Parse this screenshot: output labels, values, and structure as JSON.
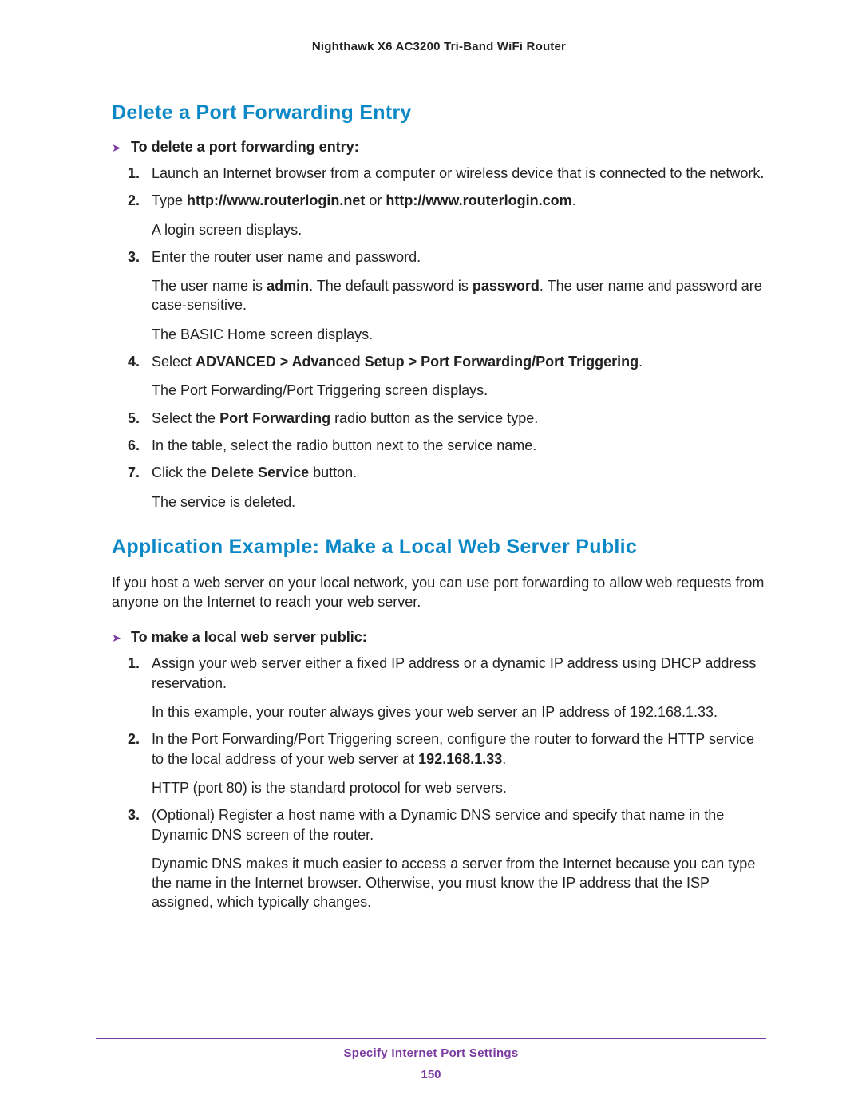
{
  "running_header": "Nighthawk X6 AC3200 Tri-Band WiFi Router",
  "section1": {
    "title": "Delete a Port Forwarding Entry",
    "lead": "To delete a port forwarding entry:",
    "steps": {
      "s1": "Launch an Internet browser from a computer or wireless device that is connected to the network.",
      "s2_pre": "Type ",
      "s2_b1": "http://www.routerlogin.net",
      "s2_mid": " or ",
      "s2_b2": "http://www.routerlogin.com",
      "s2_post": ".",
      "s2_p1": "A login screen displays.",
      "s3": "Enter the router user name and password.",
      "s3_p1_a": "The user name is ",
      "s3_p1_b1": "admin",
      "s3_p1_b": ". The default password is ",
      "s3_p1_b2": "password",
      "s3_p1_c": ". The user name and password are case-sensitive.",
      "s3_p2": "The BASIC Home screen displays.",
      "s4_pre": "Select ",
      "s4_b": "ADVANCED > Advanced Setup > Port Forwarding/Port Triggering",
      "s4_post": ".",
      "s4_p1": "The Port Forwarding/Port Triggering screen displays.",
      "s5_pre": "Select the ",
      "s5_b": "Port Forwarding",
      "s5_post": " radio button as the service type.",
      "s6": "In the table, select the radio button next to the service name.",
      "s7_pre": "Click the ",
      "s7_b": "Delete Service",
      "s7_post": " button.",
      "s7_p1": "The service is deleted."
    }
  },
  "section2": {
    "title": "Application Example: Make a Local Web Server Public",
    "intro": "If you host a web server on your local network, you can use port forwarding to allow web requests from anyone on the Internet to reach your web server.",
    "lead": "To make a local web server public:",
    "steps": {
      "s1": "Assign your web server either a fixed IP address or a dynamic IP address using DHCP address reservation.",
      "s1_p1": "In this example, your router always gives your web server an IP address of 192.168.1.33.",
      "s2_pre": "In the Port Forwarding/Port Triggering screen, configure the router to forward the HTTP service to the local address of your web server at ",
      "s2_b": "192.168.1.33",
      "s2_post": ".",
      "s2_p1": "HTTP (port 80) is the standard protocol for web servers.",
      "s3": "(Optional) Register a host name with a Dynamic DNS service and specify that name in the Dynamic DNS screen of the router.",
      "s3_p1": "Dynamic DNS makes it much easier to access a server from the Internet because you can type the name in the Internet browser. Otherwise, you must know the IP address that the ISP assigned, which typically changes."
    }
  },
  "footer": {
    "title": "Specify Internet Port Settings",
    "page": "150"
  },
  "nums": {
    "n1": "1.",
    "n2": "2.",
    "n3": "3.",
    "n4": "4.",
    "n5": "5.",
    "n6": "6.",
    "n7": "7."
  }
}
